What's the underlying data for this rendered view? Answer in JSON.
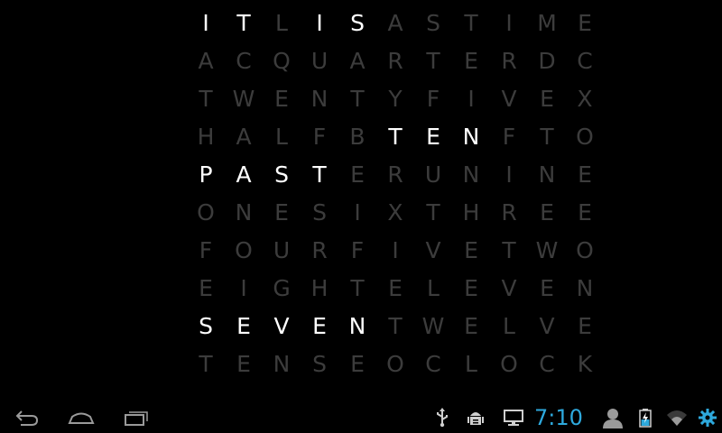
{
  "word_clock": {
    "rows": [
      {
        "letters": [
          "I",
          "T",
          "L",
          "I",
          "S",
          "A",
          "S",
          "T",
          "I",
          "M",
          "E"
        ],
        "lit": [
          0,
          1,
          3,
          4
        ]
      },
      {
        "letters": [
          "A",
          "C",
          "Q",
          "U",
          "A",
          "R",
          "T",
          "E",
          "R",
          "D",
          "C"
        ],
        "lit": []
      },
      {
        "letters": [
          "T",
          "W",
          "E",
          "N",
          "T",
          "Y",
          "F",
          "I",
          "V",
          "E",
          "X"
        ],
        "lit": []
      },
      {
        "letters": [
          "H",
          "A",
          "L",
          "F",
          "B",
          "T",
          "E",
          "N",
          "F",
          "T",
          "O"
        ],
        "lit": [
          5,
          6,
          7
        ]
      },
      {
        "letters": [
          "P",
          "A",
          "S",
          "T",
          "E",
          "R",
          "U",
          "N",
          "I",
          "N",
          "E"
        ],
        "lit": [
          0,
          1,
          2,
          3
        ]
      },
      {
        "letters": [
          "O",
          "N",
          "E",
          "S",
          "I",
          "X",
          "T",
          "H",
          "R",
          "E",
          "E"
        ],
        "lit": []
      },
      {
        "letters": [
          "F",
          "O",
          "U",
          "R",
          "F",
          "I",
          "V",
          "E",
          "T",
          "W",
          "O"
        ],
        "lit": []
      },
      {
        "letters": [
          "E",
          "I",
          "G",
          "H",
          "T",
          "E",
          "L",
          "E",
          "V",
          "E",
          "N"
        ],
        "lit": []
      },
      {
        "letters": [
          "S",
          "E",
          "V",
          "E",
          "N",
          "T",
          "W",
          "E",
          "L",
          "V",
          "E"
        ],
        "lit": [
          0,
          1,
          2,
          3,
          4
        ]
      },
      {
        "letters": [
          "T",
          "E",
          "N",
          "S",
          "E",
          "O",
          "C",
          "L",
          "O",
          "C",
          "K"
        ],
        "lit": []
      }
    ],
    "lit_color": "#ffffff",
    "dim_color": "#3c3c3c"
  },
  "system_bar": {
    "nav": [
      "back-icon",
      "home-icon",
      "recent-apps-icon"
    ],
    "status_icons": [
      "usb-icon",
      "android-debug-icon",
      "screen-icon"
    ],
    "clock": "7:10",
    "clock_color": "#2ea9dd",
    "right_icons": [
      "user-icon",
      "battery-icon",
      "wifi-icon",
      "settings-icon"
    ]
  }
}
